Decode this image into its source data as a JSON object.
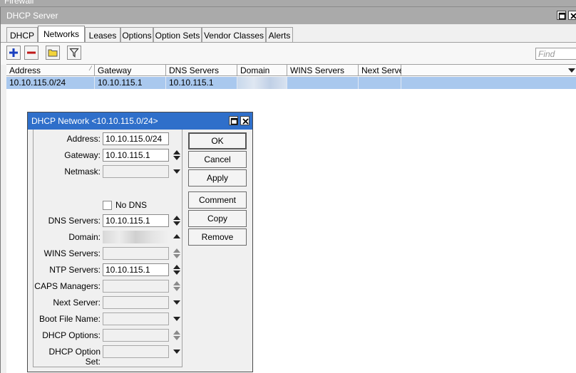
{
  "background_window": {
    "title": "Firewall"
  },
  "window": {
    "title": "DHCP Server"
  },
  "tabs": [
    {
      "label": "DHCP"
    },
    {
      "label": "Networks"
    },
    {
      "label": "Leases"
    },
    {
      "label": "Options"
    },
    {
      "label": "Option Sets"
    },
    {
      "label": "Vendor Classes"
    },
    {
      "label": "Alerts"
    }
  ],
  "active_tab": "Networks",
  "toolbar": {
    "find_placeholder": "Find",
    "icons": [
      "plus-icon",
      "minus-icon",
      "comment-note-icon",
      "filter-icon"
    ]
  },
  "table": {
    "columns": [
      "Address",
      "Gateway",
      "DNS Servers",
      "Domain",
      "WINS Servers",
      "Next Server"
    ],
    "rows": [
      {
        "address": "10.10.115.0/24",
        "gateway": "10.10.115.1",
        "dns_servers": "10.10.115.1",
        "domain": "",
        "wins_servers": "",
        "next_server": ""
      }
    ]
  },
  "dialog": {
    "title": "DHCP Network <10.10.115.0/24>",
    "fields": {
      "address": {
        "label": "Address:",
        "value": "10.10.115.0/24"
      },
      "gateway": {
        "label": "Gateway:",
        "value": "10.10.115.1"
      },
      "netmask": {
        "label": "Netmask:",
        "value": ""
      },
      "no_dns": {
        "label": "No DNS",
        "checked": false
      },
      "dns_servers": {
        "label": "DNS Servers:",
        "value": "10.10.115.1"
      },
      "domain": {
        "label": "Domain:",
        "value": ""
      },
      "wins_servers": {
        "label": "WINS Servers:",
        "value": ""
      },
      "ntp_servers": {
        "label": "NTP Servers:",
        "value": "10.10.115.1"
      },
      "caps_managers": {
        "label": "CAPS Managers:",
        "value": ""
      },
      "next_server": {
        "label": "Next Server:",
        "value": ""
      },
      "boot_file_name": {
        "label": "Boot File Name:",
        "value": ""
      },
      "dhcp_options": {
        "label": "DHCP Options:",
        "value": ""
      },
      "dhcp_option_set": {
        "label": "DHCP Option Set:",
        "value": ""
      }
    },
    "buttons": {
      "ok": "OK",
      "cancel": "Cancel",
      "apply": "Apply",
      "comment": "Comment",
      "copy": "Copy",
      "remove": "Remove"
    }
  },
  "colors": {
    "dialog_title_bg": "#2f6fca",
    "selected_row": "#a9c8ee",
    "add_icon": "#1a3fbf",
    "remove_icon": "#c01818",
    "note_icon": "#f2d33a"
  }
}
